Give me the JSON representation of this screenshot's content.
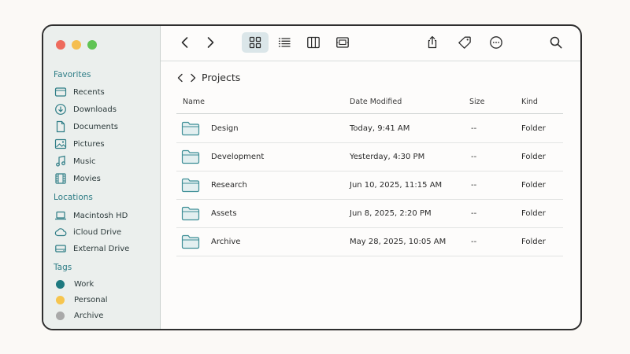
{
  "colors": {
    "close": "#ee6b5d",
    "minimize": "#f5be4f",
    "zoom": "#60c454",
    "accent": "#2e7d86",
    "tag_work": "#1f7a80",
    "tag_personal": "#f6c54f",
    "tag_archive": "#a9a9a9"
  },
  "sidebar": {
    "favorites_heading": "Favorites",
    "favorites": [
      {
        "label": "Recents",
        "icon": "folder-icon"
      },
      {
        "label": "Downloads",
        "icon": "download-icon"
      },
      {
        "label": "Documents",
        "icon": "document-icon"
      },
      {
        "label": "Pictures",
        "icon": "picture-icon"
      },
      {
        "label": "Music",
        "icon": "music-icon"
      },
      {
        "label": "Movies",
        "icon": "film-icon"
      }
    ],
    "locations_heading": "Locations",
    "locations": [
      {
        "label": "Macintosh HD",
        "icon": "laptop-icon"
      },
      {
        "label": "iCloud Drive",
        "icon": "cloud-icon"
      },
      {
        "label": "External Drive",
        "icon": "drive-icon"
      }
    ],
    "tags_heading": "Tags",
    "tags": [
      {
        "label": "Work",
        "color": "#1f7a80"
      },
      {
        "label": "Personal",
        "color": "#f6c54f"
      },
      {
        "label": "Archive",
        "color": "#a9a9a9"
      }
    ]
  },
  "toolbar": {
    "icons": [
      "back-icon",
      "forward-icon",
      "grid-view-icon",
      "list-view-icon",
      "column-view-icon",
      "gallery-view-icon",
      "share-icon",
      "tag-icon",
      "more-icon",
      "search-icon"
    ]
  },
  "breadcrumb": {
    "title": "Projects"
  },
  "table": {
    "headers": {
      "name": "Name",
      "date": "Date Modified",
      "size": "Size",
      "kind": "Kind"
    },
    "rows": [
      {
        "name": "Design",
        "date": "Today, 9:41 AM",
        "size": "--",
        "kind": "Folder"
      },
      {
        "name": "Development",
        "date": "Yesterday, 4:30 PM",
        "size": "--",
        "kind": "Folder"
      },
      {
        "name": "Research",
        "date": "Jun 10, 2025, 11:15 AM",
        "size": "--",
        "kind": "Folder"
      },
      {
        "name": "Assets",
        "date": "Jun 8, 2025, 2:20 PM",
        "size": "--",
        "kind": "Folder"
      },
      {
        "name": "Archive",
        "date": "May 28, 2025, 10:05 AM",
        "size": "--",
        "kind": "Folder"
      }
    ]
  }
}
